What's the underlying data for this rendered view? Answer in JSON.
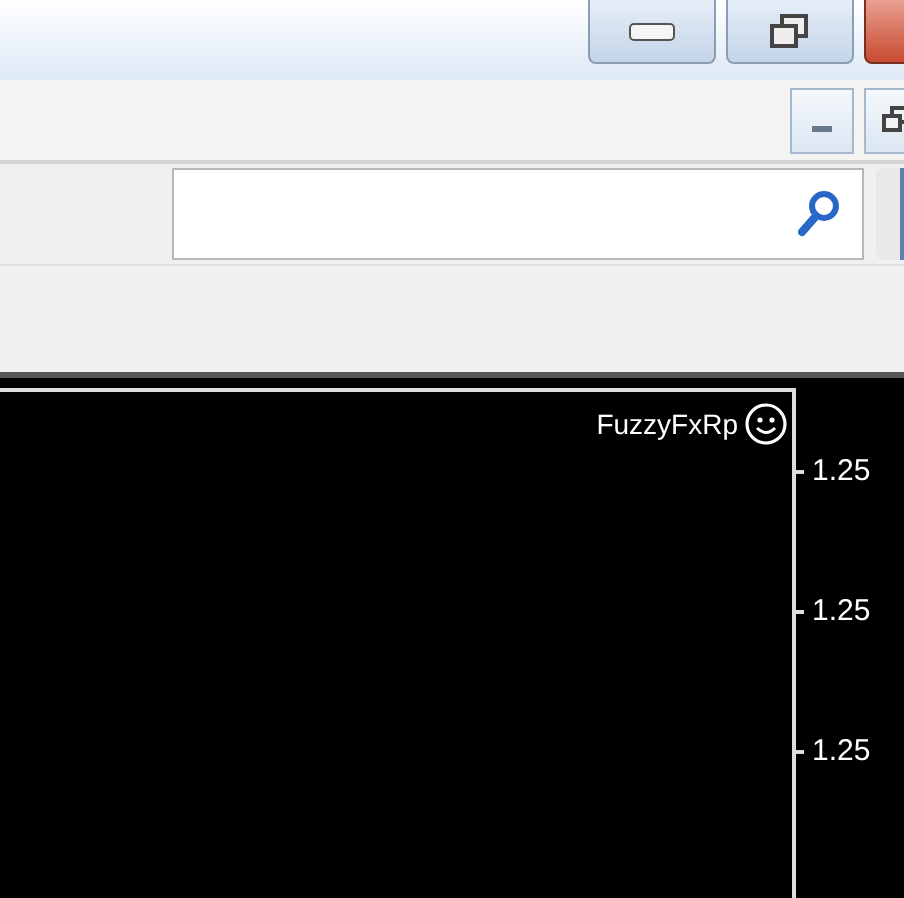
{
  "chart": {
    "indicator_label": "FuzzyFxRp",
    "price_labels": [
      "1.25",
      "1.25",
      "1.25"
    ]
  }
}
